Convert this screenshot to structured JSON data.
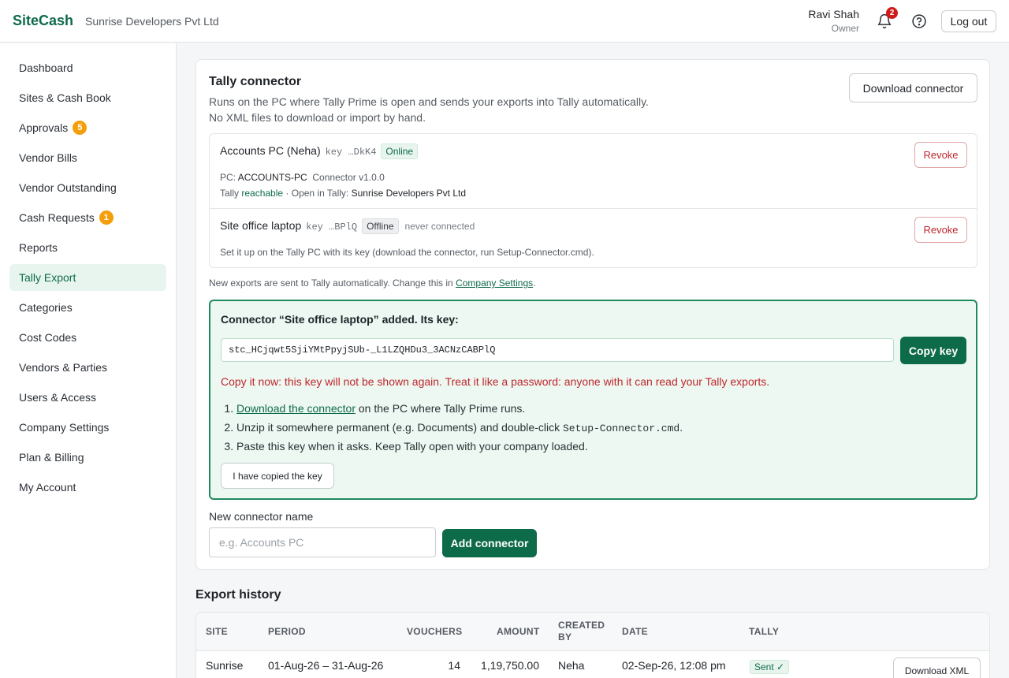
{
  "header": {
    "brand": "SiteCash",
    "company": "Sunrise Developers Pvt Ltd",
    "user_name": "Ravi Shah",
    "user_role": "Owner",
    "notification_count": "2",
    "logout_label": "Log out"
  },
  "sidebar": {
    "items": [
      {
        "label": "Dashboard"
      },
      {
        "label": "Sites & Cash Book"
      },
      {
        "label": "Approvals",
        "badge": "5"
      },
      {
        "label": "Vendor Bills"
      },
      {
        "label": "Vendor Outstanding"
      },
      {
        "label": "Cash Requests",
        "badge": "1"
      },
      {
        "label": "Reports"
      },
      {
        "label": "Tally Export",
        "active": true
      },
      {
        "label": "Categories"
      },
      {
        "label": "Cost Codes"
      },
      {
        "label": "Vendors & Parties"
      },
      {
        "label": "Users & Access"
      },
      {
        "label": "Company Settings"
      },
      {
        "label": "Plan & Billing"
      },
      {
        "label": "My Account"
      }
    ]
  },
  "connector": {
    "title": "Tally connector",
    "desc_line1": "Runs on the PC where Tally Prime is open and sends your exports into Tally automatically.",
    "desc_line2": "No XML files to download or import by hand.",
    "download_label": "Download connector",
    "items": [
      {
        "name": "Accounts PC (Neha)",
        "key": "key …DkK4",
        "status": "Online",
        "pc_label": "PC:",
        "pc_name": "ACCOUNTS-PC",
        "version": "Connector v1.0.0",
        "tally_label": "Tally",
        "tally_state": "reachable",
        "open_label": "· Open in Tally:",
        "open_company": "Sunrise Developers Pvt Ltd",
        "revoke_label": "Revoke"
      },
      {
        "name": "Site office laptop",
        "key": "key …BPlQ",
        "status": "Offline",
        "note": "never connected",
        "help": "Set it up on the Tally PC with its key (download the connector, run Setup-Connector.cmd).",
        "revoke_label": "Revoke"
      }
    ],
    "auto_note_prefix": "New exports are sent to Tally automatically. Change this in",
    "auto_note_link": "Company Settings",
    "auto_note_suffix": ".",
    "keybox": {
      "title": "Connector “Site office laptop” added. Its key:",
      "key_value": "stc_HCjqwt5SjiYMtPpyjSUb-_L1LZQHDu3_3ACNzCABPlQ",
      "copy_label": "Copy key",
      "warning": "Copy it now: this key will not be shown again. Treat it like a password: anyone with it can read your Tally exports.",
      "step1_link": "Download the connector",
      "step1_rest": " on the PC where Tally Prime runs.",
      "step2_prefix": "Unzip it somewhere permanent (e.g. Documents) and double-click ",
      "step2_code": "Setup-Connector.cmd",
      "step2_suffix": ".",
      "step3": "Paste this key when it asks. Keep Tally open with your company loaded.",
      "copied_label": "I have copied the key"
    },
    "new_label": "New connector name",
    "new_placeholder": "e.g. Accounts PC",
    "add_label": "Add connector"
  },
  "history": {
    "title": "Export history",
    "columns": [
      "Site",
      "Period",
      "Vouchers",
      "Amount",
      "Created by",
      "Date",
      "Tally"
    ],
    "rows": [
      {
        "site": "Sunrise",
        "period": "01-Aug-26 – 31-Aug-26",
        "vouchers": "14",
        "amount": "1,19,750.00",
        "created_by": "Neha",
        "date": "02-Sep-26, 12:08 pm",
        "tally": "Sent ✓",
        "download_label": "Download XML"
      }
    ]
  }
}
